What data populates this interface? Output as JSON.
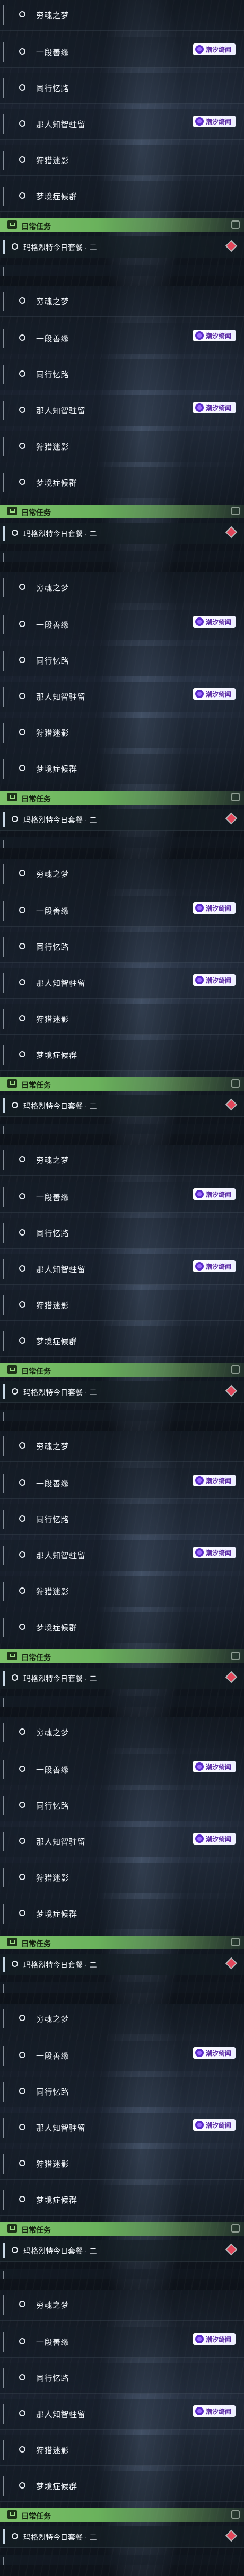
{
  "quest_list": {
    "items": [
      {
        "label": "穷魂之梦",
        "tag": null
      },
      {
        "label": "一段善缘",
        "tag": "潮汐绮闻"
      },
      {
        "label": "同行忆路",
        "tag": null
      },
      {
        "label": "那人知智驻留",
        "tag": "潮汐绮闻"
      },
      {
        "label": "狩猎迷影",
        "tag": null
      },
      {
        "label": "梦境症候群",
        "tag": null
      }
    ]
  },
  "daily": {
    "header_label": "日常任务",
    "item_label": "玛格烈特今日套餐 · 二"
  },
  "panel_count": 9
}
